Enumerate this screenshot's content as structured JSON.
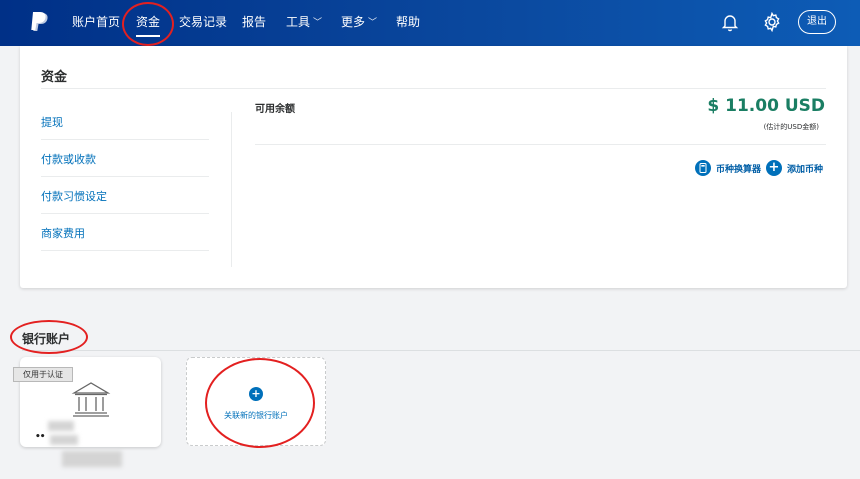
{
  "nav": {
    "items": [
      {
        "label": "账户首页"
      },
      {
        "label": "资金"
      },
      {
        "label": "交易记录"
      },
      {
        "label": "报告"
      },
      {
        "label": "工具"
      },
      {
        "label": "更多"
      },
      {
        "label": "帮助"
      }
    ],
    "active": "资金",
    "logout_label": "退出"
  },
  "funds": {
    "title": "资金",
    "sidebar": [
      {
        "label": "提现"
      },
      {
        "label": "付款或收款"
      },
      {
        "label": "付款习惯设定"
      },
      {
        "label": "商家费用"
      }
    ],
    "balance_label": "可用余额",
    "balance_amount": "$ 11.00 USD",
    "balance_note": "(估计的USD金额)",
    "actions": [
      {
        "label": "币种换算器"
      },
      {
        "label": "添加币种"
      }
    ]
  },
  "bank": {
    "title": "银行账户",
    "card_tag": "仅用于认证",
    "card_mask": "••",
    "add_label": "关联新的银行账户"
  },
  "colors": {
    "nav_bg": "#003087",
    "link": "#0070ba",
    "balance": "#1a7e63",
    "annotation": "#e32020"
  },
  "icons": [
    "paypal-logo",
    "bell-icon",
    "gear-icon",
    "bank-icon",
    "plus-icon",
    "calculator-icon",
    "add-circle-icon"
  ]
}
